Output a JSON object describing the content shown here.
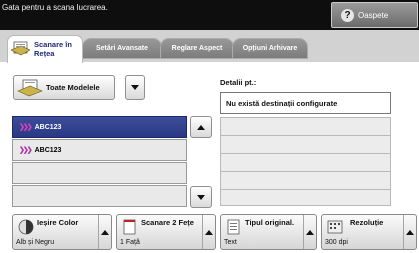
{
  "header": {
    "status_text": "Gata pentru a scana lucrarea.",
    "guest_label": "Oaspete",
    "guest_icon": "?"
  },
  "tabs": [
    {
      "label_line1": "Scanare în",
      "label_line2": "Rețea",
      "active": true
    },
    {
      "label": "Setări Avansate"
    },
    {
      "label": "Reglare Aspect"
    },
    {
      "label": "Opțiuni Arhivare"
    }
  ],
  "left": {
    "models_label": "Toate Modelele",
    "addresses": [
      "ABC123",
      "ABC123",
      "",
      ""
    ]
  },
  "right": {
    "details_label": "Detalii pt.:",
    "destinations": [
      "Nu există destinații configurate",
      "",
      "",
      "",
      "",
      ""
    ]
  },
  "features": [
    {
      "title": "Ieșire Color",
      "value": "Alb și Negru"
    },
    {
      "title": "Scanare 2 Fețe",
      "value": "1 Față"
    },
    {
      "title": "Tipul original.",
      "value": "Text"
    },
    {
      "title": "Rezoluție",
      "value": "300 dpi"
    }
  ],
  "colors": {
    "selected_row": "#2f3d8c",
    "tab_active_text": "#1f2a7a",
    "chevron": "#d040b8"
  }
}
